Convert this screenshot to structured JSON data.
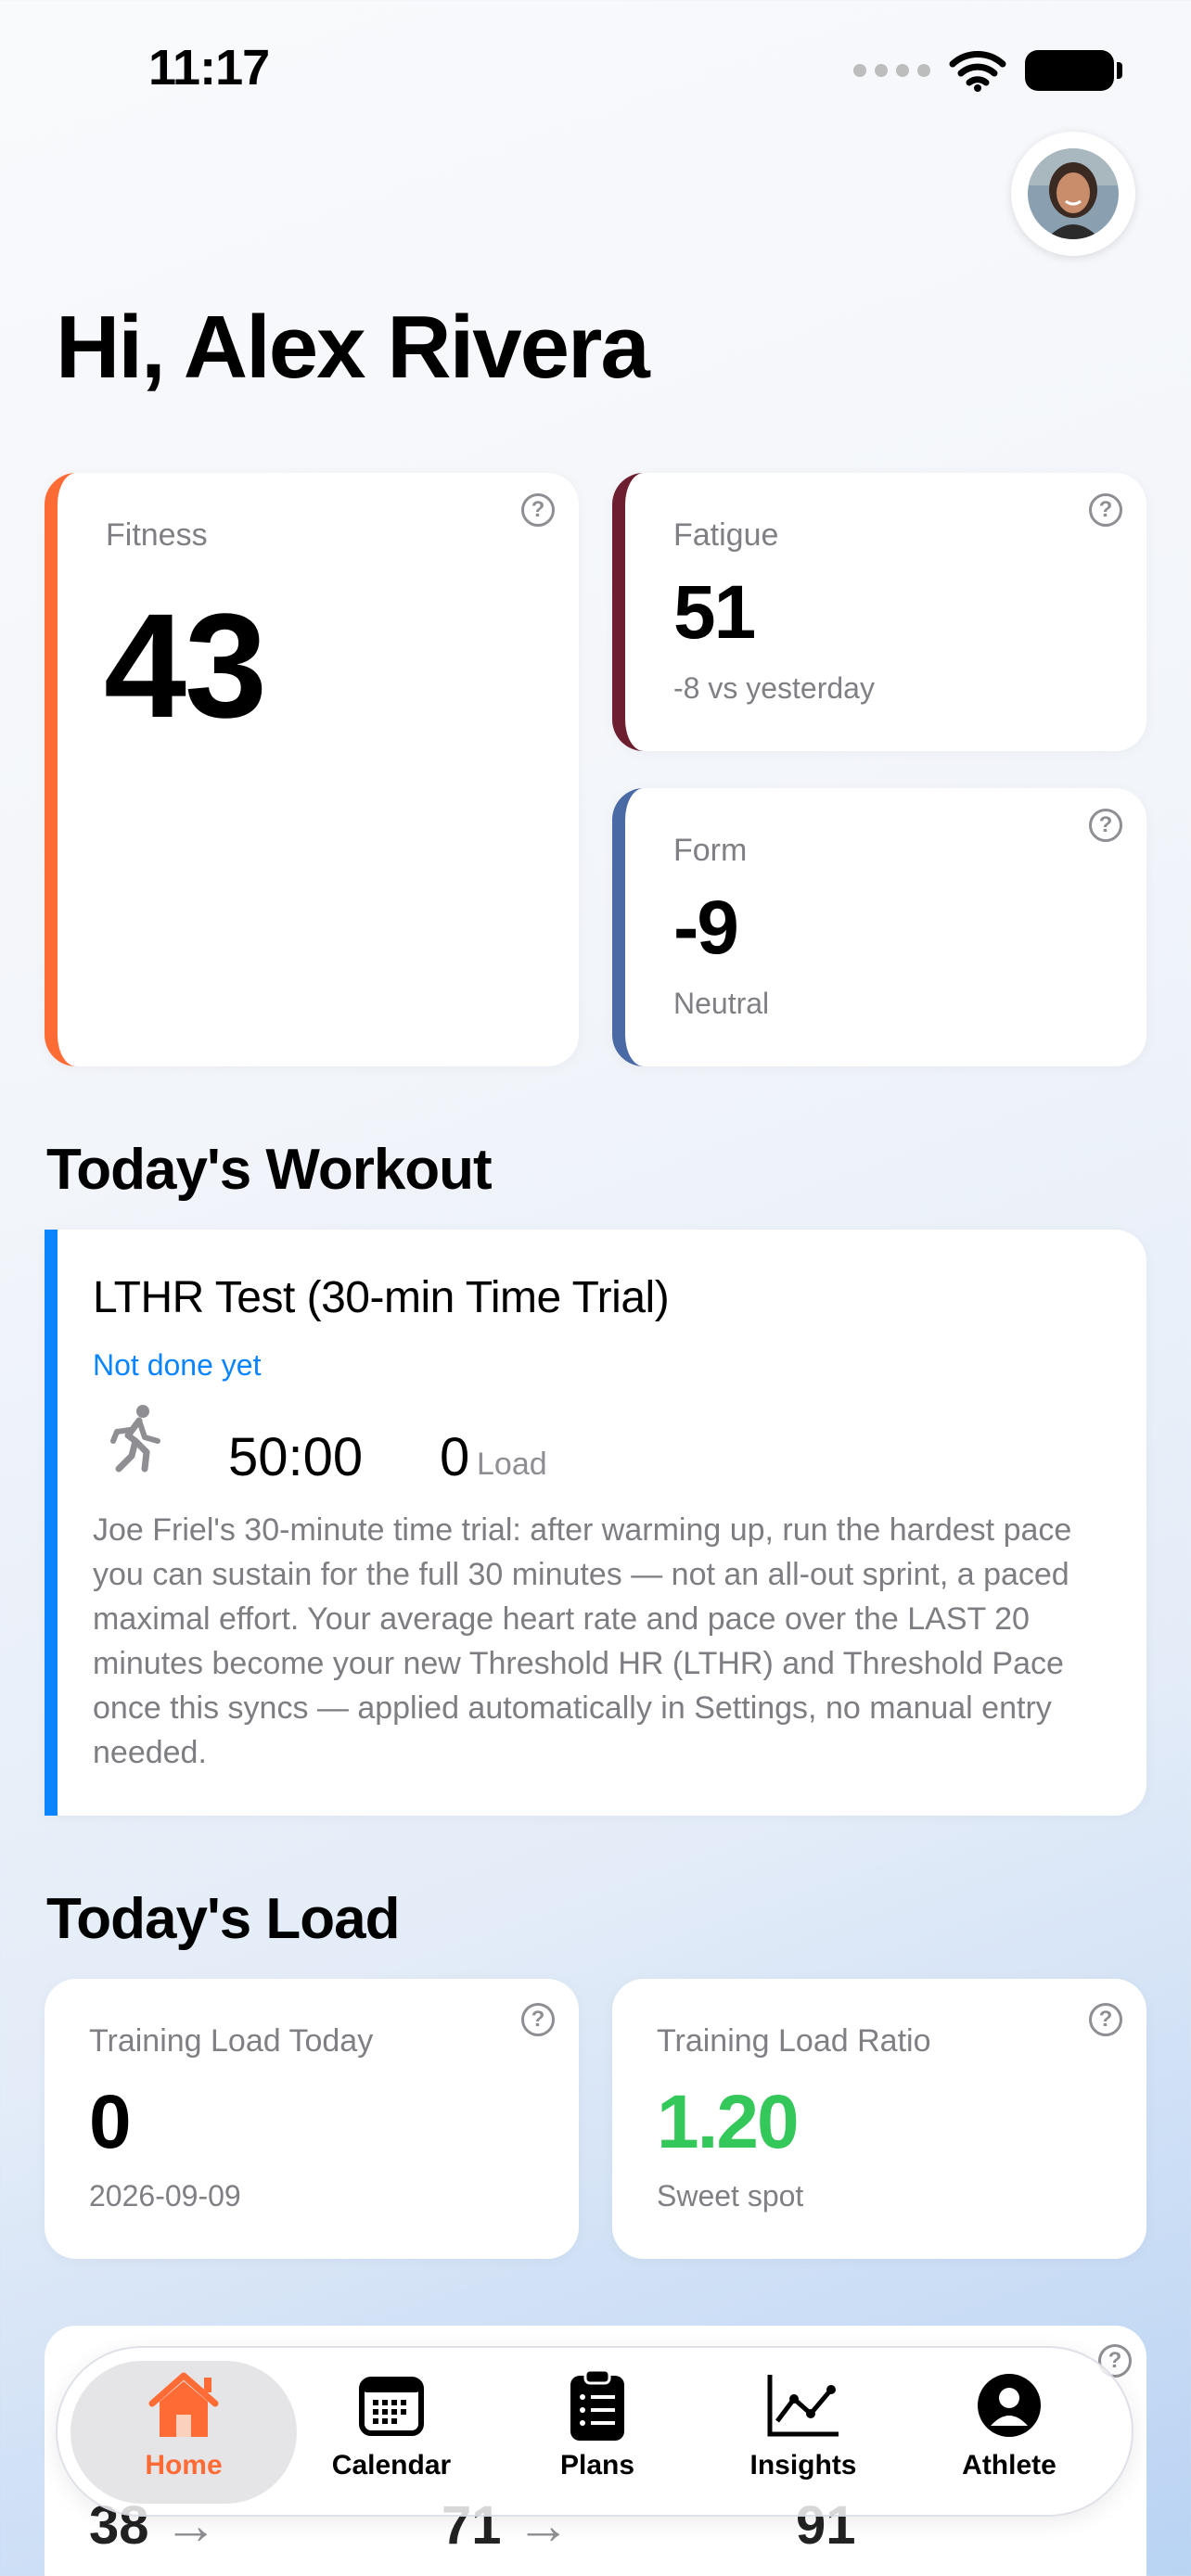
{
  "status_bar": {
    "time": "11:17"
  },
  "header": {
    "greeting": "Hi, Alex Rivera"
  },
  "fitness": {
    "label": "Fitness",
    "value": "43",
    "accent": "#ff6b35"
  },
  "fatigue": {
    "label": "Fatigue",
    "value": "51",
    "delta": "-8 vs yesterday",
    "accent": "#6e1f2f"
  },
  "form": {
    "label": "Form",
    "value": "-9",
    "status": "Neutral",
    "accent": "#4a6aa5"
  },
  "todays_workout": {
    "section_title": "Today's Workout",
    "title": "LTHR Test (30-min Time Trial)",
    "status": "Not done yet",
    "duration": "50:00",
    "load_value": "0",
    "load_label": "Load",
    "description": "Joe Friel's 30-minute time trial: after warming up, run the hardest pace you can sustain for the full 30 minutes — not an all-out sprint, a paced maximal effort. Your average heart rate and pace over the LAST 20 minutes become your new Threshold HR (LTHR) and Threshold Pace once this syncs — applied automatically in Settings, no manual entry needed.",
    "accent": "#0a84ff"
  },
  "todays_load": {
    "section_title": "Today's Load",
    "training_load_today": {
      "label": "Training Load Today",
      "value": "0",
      "date": "2026-09-09"
    },
    "training_load_ratio": {
      "label": "Training Load Ratio",
      "value": "1.20",
      "status": "Sweet spot",
      "value_color": "#34c759"
    }
  },
  "peek_row": {
    "values": [
      "38",
      "71",
      "91"
    ]
  },
  "tab_bar": {
    "tabs": [
      {
        "label": "Home",
        "icon": "home-icon",
        "active": true
      },
      {
        "label": "Calendar",
        "icon": "calendar-icon",
        "active": false
      },
      {
        "label": "Plans",
        "icon": "clipboard-icon",
        "active": false
      },
      {
        "label": "Insights",
        "icon": "chart-icon",
        "active": false
      },
      {
        "label": "Athlete",
        "icon": "person-icon",
        "active": false
      }
    ]
  }
}
